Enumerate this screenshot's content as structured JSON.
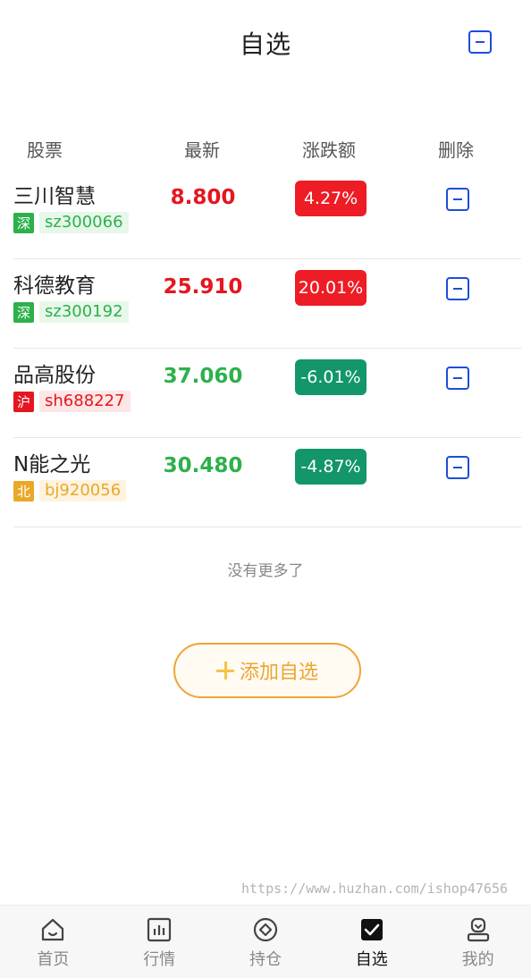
{
  "header": {
    "title": "自选"
  },
  "columns": {
    "stock": "股票",
    "latest": "最新",
    "change": "涨跌额",
    "delete": "删除"
  },
  "rows": [
    {
      "name": "三川智慧",
      "market": "深",
      "code": "sz300066",
      "price": "8.800",
      "change": "4.27%",
      "trend": "up",
      "market_type": "sz"
    },
    {
      "name": "科德教育",
      "market": "深",
      "code": "sz300192",
      "price": "25.910",
      "change": "20.01%",
      "trend": "up",
      "market_type": "sz"
    },
    {
      "name": "品高股份",
      "market": "沪",
      "code": "sh688227",
      "price": "37.060",
      "change": "-6.01%",
      "trend": "down",
      "market_type": "sh"
    },
    {
      "name": "N能之光",
      "market": "北",
      "code": "bj920056",
      "price": "30.480",
      "change": "-4.87%",
      "trend": "down",
      "market_type": "bj"
    }
  ],
  "footer_note": "没有更多了",
  "add_button": {
    "label": "添加自选"
  },
  "watermark": "https://www.huzhan.com/ishop47656",
  "tabs": [
    {
      "label": "首页",
      "icon": "home-icon"
    },
    {
      "label": "行情",
      "icon": "chart-icon"
    },
    {
      "label": "持仓",
      "icon": "position-icon"
    },
    {
      "label": "自选",
      "icon": "checkbox-icon",
      "active": true
    },
    {
      "label": "我的",
      "icon": "user-icon"
    }
  ],
  "colors": {
    "up": "#e5161f",
    "down": "#2db14b",
    "accent": "#1d4ed8",
    "add": "#eea534"
  }
}
